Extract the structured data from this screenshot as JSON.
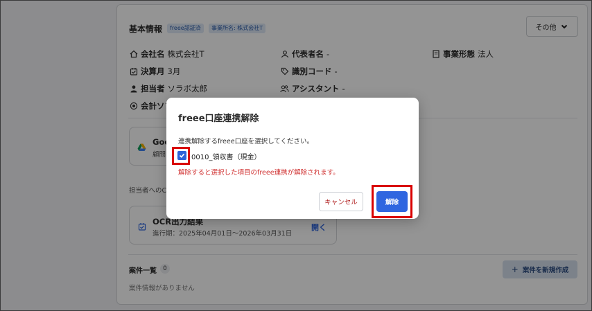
{
  "basic_info": {
    "title": "基本情報",
    "tags": [
      "freee認証済",
      "事業所名: 株式会社T"
    ],
    "other_button": "その他"
  },
  "fields": {
    "company_label": "会社名",
    "company_value": "株式会社T",
    "rep_label": "代表者名",
    "rep_value": "-",
    "biz_label": "事業形態",
    "biz_value": "法人",
    "fiscal_label": "決算月",
    "fiscal_value": "3月",
    "id_label": "識別コード",
    "id_value": "-",
    "owner_label": "担当者",
    "owner_value": "ソラボ太郎",
    "assistant_label": "アシスタント",
    "assistant_value": "-",
    "software_label": "会計ソフト"
  },
  "google_card": {
    "title": "Goo",
    "sub": "顧問"
  },
  "contact_note": "担当者へのC",
  "ocr_card": {
    "title": "OCR出力結果",
    "period": "進行期：2025年04月01日〜2026年03月31日",
    "open": "開く"
  },
  "cases": {
    "title": "案件一覧",
    "count": "0",
    "new_button": "案件を新規作成",
    "empty": "案件情報がありません"
  },
  "modal": {
    "title": "freee口座連携解除",
    "description": "連携解除するfreee口座を選択してください。",
    "item_label": "0010_領収書（現金）",
    "warning": "解除すると選択した項目のfreee連携が解除されます。",
    "cancel": "キャンセル",
    "confirm": "解除"
  },
  "colors": {
    "primary": "#2f66e0",
    "danger": "#d03030",
    "highlight": "#d90000"
  }
}
